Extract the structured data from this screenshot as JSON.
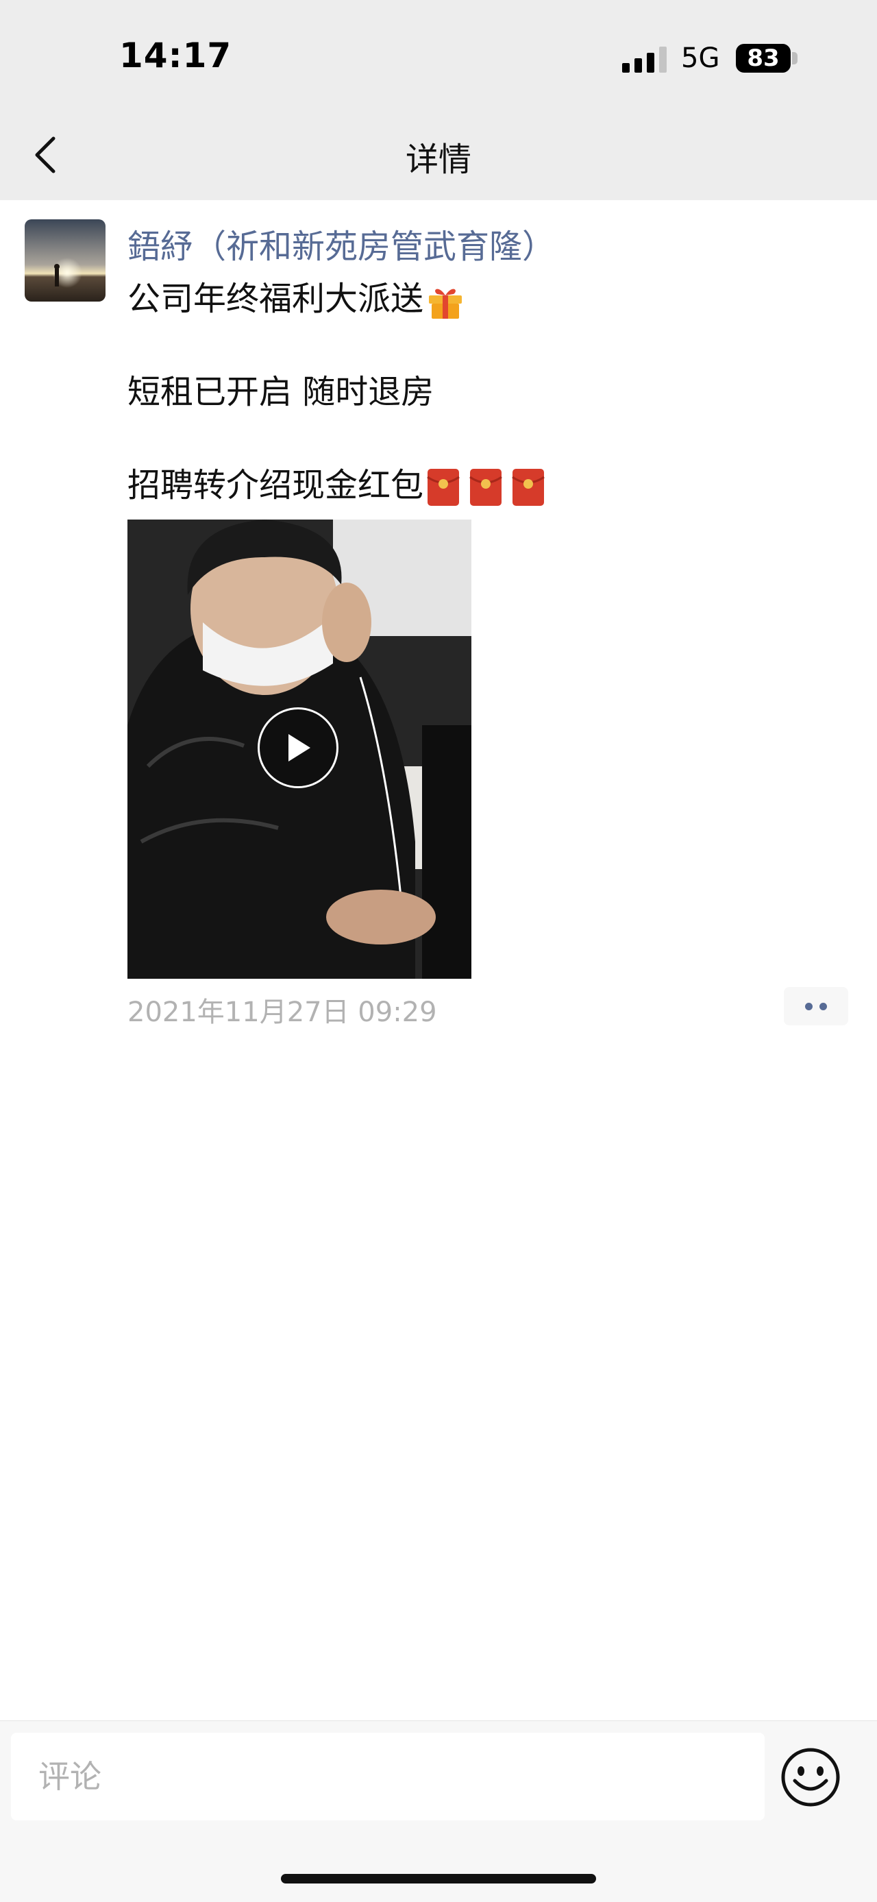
{
  "status_bar": {
    "time": "14:17",
    "network": "5G",
    "battery": "83",
    "icons": [
      "signal-icon",
      "battery-icon"
    ]
  },
  "nav": {
    "title": "详情",
    "back_icon": "chevron-left-icon"
  },
  "post": {
    "author": "鋙紓（祈和新苑房管武育隆）",
    "lines": [
      "公司年终福利大派送",
      "短租已开启  随时退房",
      "招聘转介绍现金红包"
    ],
    "line1_emoji": "gift-icon",
    "line3_emojis": [
      "red-envelope-icon",
      "red-envelope-icon",
      "red-envelope-icon"
    ],
    "video_icon": "play-icon",
    "timestamp": "2021年11月27日 09:29",
    "more_icon": "more-dots-icon"
  },
  "comment_bar": {
    "placeholder": "评论",
    "emoji_icon": "smiley-icon"
  },
  "colors": {
    "link": "#576b95",
    "bar_bg": "#ededed",
    "muted": "#b2b2b2"
  }
}
